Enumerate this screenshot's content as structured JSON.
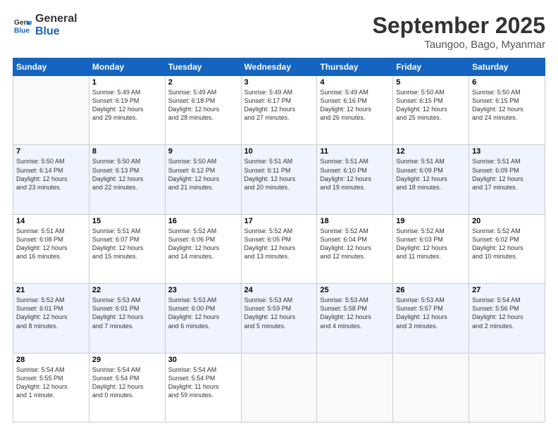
{
  "logo": {
    "text_general": "General",
    "text_blue": "Blue"
  },
  "title": "September 2025",
  "location": "Taungoo, Bago, Myanmar",
  "days_header": [
    "Sunday",
    "Monday",
    "Tuesday",
    "Wednesday",
    "Thursday",
    "Friday",
    "Saturday"
  ],
  "weeks": [
    [
      {
        "day": "",
        "info": ""
      },
      {
        "day": "1",
        "info": "Sunrise: 5:49 AM\nSunset: 6:19 PM\nDaylight: 12 hours\nand 29 minutes."
      },
      {
        "day": "2",
        "info": "Sunrise: 5:49 AM\nSunset: 6:18 PM\nDaylight: 12 hours\nand 28 minutes."
      },
      {
        "day": "3",
        "info": "Sunrise: 5:49 AM\nSunset: 6:17 PM\nDaylight: 12 hours\nand 27 minutes."
      },
      {
        "day": "4",
        "info": "Sunrise: 5:49 AM\nSunset: 6:16 PM\nDaylight: 12 hours\nand 26 minutes."
      },
      {
        "day": "5",
        "info": "Sunrise: 5:50 AM\nSunset: 6:15 PM\nDaylight: 12 hours\nand 25 minutes."
      },
      {
        "day": "6",
        "info": "Sunrise: 5:50 AM\nSunset: 6:15 PM\nDaylight: 12 hours\nand 24 minutes."
      }
    ],
    [
      {
        "day": "7",
        "info": "Sunrise: 5:50 AM\nSunset: 6:14 PM\nDaylight: 12 hours\nand 23 minutes."
      },
      {
        "day": "8",
        "info": "Sunrise: 5:50 AM\nSunset: 6:13 PM\nDaylight: 12 hours\nand 22 minutes."
      },
      {
        "day": "9",
        "info": "Sunrise: 5:50 AM\nSunset: 6:12 PM\nDaylight: 12 hours\nand 21 minutes."
      },
      {
        "day": "10",
        "info": "Sunrise: 5:51 AM\nSunset: 6:11 PM\nDaylight: 12 hours\nand 20 minutes."
      },
      {
        "day": "11",
        "info": "Sunrise: 5:51 AM\nSunset: 6:10 PM\nDaylight: 12 hours\nand 19 minutes."
      },
      {
        "day": "12",
        "info": "Sunrise: 5:51 AM\nSunset: 6:09 PM\nDaylight: 12 hours\nand 18 minutes."
      },
      {
        "day": "13",
        "info": "Sunrise: 5:51 AM\nSunset: 6:09 PM\nDaylight: 12 hours\nand 17 minutes."
      }
    ],
    [
      {
        "day": "14",
        "info": "Sunrise: 5:51 AM\nSunset: 6:08 PM\nDaylight: 12 hours\nand 16 minutes."
      },
      {
        "day": "15",
        "info": "Sunrise: 5:51 AM\nSunset: 6:07 PM\nDaylight: 12 hours\nand 15 minutes."
      },
      {
        "day": "16",
        "info": "Sunrise: 5:52 AM\nSunset: 6:06 PM\nDaylight: 12 hours\nand 14 minutes."
      },
      {
        "day": "17",
        "info": "Sunrise: 5:52 AM\nSunset: 6:05 PM\nDaylight: 12 hours\nand 13 minutes."
      },
      {
        "day": "18",
        "info": "Sunrise: 5:52 AM\nSunset: 6:04 PM\nDaylight: 12 hours\nand 12 minutes."
      },
      {
        "day": "19",
        "info": "Sunrise: 5:52 AM\nSunset: 6:03 PM\nDaylight: 12 hours\nand 11 minutes."
      },
      {
        "day": "20",
        "info": "Sunrise: 5:52 AM\nSunset: 6:02 PM\nDaylight: 12 hours\nand 10 minutes."
      }
    ],
    [
      {
        "day": "21",
        "info": "Sunrise: 5:52 AM\nSunset: 6:01 PM\nDaylight: 12 hours\nand 8 minutes."
      },
      {
        "day": "22",
        "info": "Sunrise: 5:53 AM\nSunset: 6:01 PM\nDaylight: 12 hours\nand 7 minutes."
      },
      {
        "day": "23",
        "info": "Sunrise: 5:53 AM\nSunset: 6:00 PM\nDaylight: 12 hours\nand 6 minutes."
      },
      {
        "day": "24",
        "info": "Sunrise: 5:53 AM\nSunset: 5:59 PM\nDaylight: 12 hours\nand 5 minutes."
      },
      {
        "day": "25",
        "info": "Sunrise: 5:53 AM\nSunset: 5:58 PM\nDaylight: 12 hours\nand 4 minutes."
      },
      {
        "day": "26",
        "info": "Sunrise: 5:53 AM\nSunset: 5:57 PM\nDaylight: 12 hours\nand 3 minutes."
      },
      {
        "day": "27",
        "info": "Sunrise: 5:54 AM\nSunset: 5:56 PM\nDaylight: 12 hours\nand 2 minutes."
      }
    ],
    [
      {
        "day": "28",
        "info": "Sunrise: 5:54 AM\nSunset: 5:55 PM\nDaylight: 12 hours\nand 1 minute."
      },
      {
        "day": "29",
        "info": "Sunrise: 5:54 AM\nSunset: 5:54 PM\nDaylight: 12 hours\nand 0 minutes."
      },
      {
        "day": "30",
        "info": "Sunrise: 5:54 AM\nSunset: 5:54 PM\nDaylight: 11 hours\nand 59 minutes."
      },
      {
        "day": "",
        "info": ""
      },
      {
        "day": "",
        "info": ""
      },
      {
        "day": "",
        "info": ""
      },
      {
        "day": "",
        "info": ""
      }
    ]
  ]
}
